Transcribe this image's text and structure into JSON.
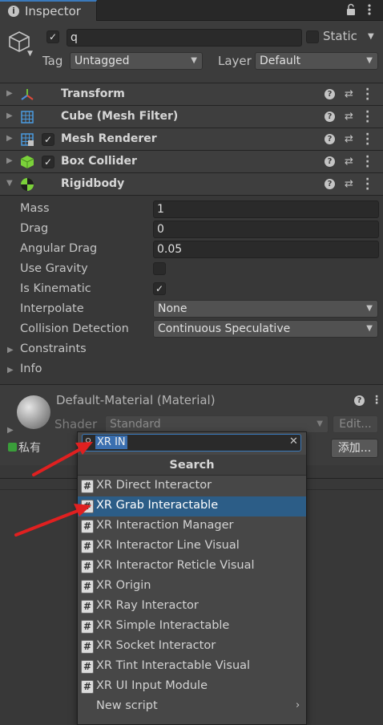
{
  "tab": {
    "title": "Inspector",
    "icon": "info-icon"
  },
  "header": {
    "name_value": "q",
    "static_label": "Static",
    "tag_label": "Tag",
    "tag_value": "Untagged",
    "layer_label": "Layer",
    "layer_value": "Default"
  },
  "components": [
    {
      "title": "Transform",
      "icon": "transform-icon",
      "has_checkbox": false
    },
    {
      "title": "Cube (Mesh Filter)",
      "icon": "mesh-filter-icon",
      "has_checkbox": false
    },
    {
      "title": "Mesh Renderer",
      "icon": "mesh-renderer-icon",
      "has_checkbox": true
    },
    {
      "title": "Box Collider",
      "icon": "box-collider-icon",
      "has_checkbox": true
    },
    {
      "title": "Rigidbody",
      "icon": "rigidbody-icon",
      "has_checkbox": false,
      "expanded": true
    }
  ],
  "rigidbody": {
    "mass_label": "Mass",
    "mass_value": "1",
    "drag_label": "Drag",
    "drag_value": "0",
    "angular_drag_label": "Angular Drag",
    "angular_drag_value": "0.05",
    "use_gravity_label": "Use Gravity",
    "use_gravity_checked": false,
    "is_kinematic_label": "Is Kinematic",
    "is_kinematic_checked": true,
    "interpolate_label": "Interpolate",
    "interpolate_value": "None",
    "collision_label": "Collision Detection",
    "collision_value": "Continuous Speculative",
    "constraints_label": "Constraints",
    "info_label": "Info"
  },
  "material": {
    "title": "Default-Material (Material)",
    "shader_label": "Shader",
    "shader_value": "Standard",
    "edit_label": "Edit...",
    "private_label": "私有",
    "add_label": "添加..."
  },
  "popup": {
    "search_value": "XR IN",
    "header": "Search",
    "items": [
      "XR Direct Interactor",
      "XR Grab Interactable",
      "XR Interaction Manager",
      "XR Interactor Line Visual",
      "XR Interactor Reticle Visual",
      "XR Origin",
      "XR Ray Interactor",
      "XR Simple Interactable",
      "XR Socket Interactor",
      "XR Tint Interactable Visual",
      "XR UI Input Module"
    ],
    "selected_index": 1,
    "new_script_label": "New script"
  },
  "colors": {
    "accent": "#3a79bb",
    "selection": "#2c5d87",
    "annotation_arrow": "#e02020"
  }
}
